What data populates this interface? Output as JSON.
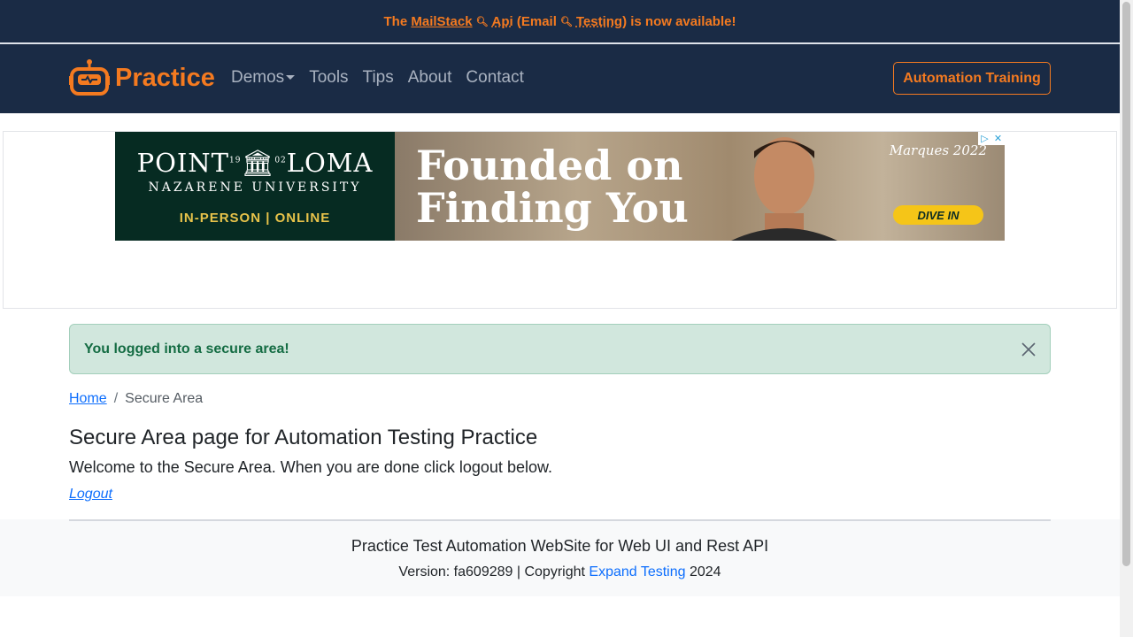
{
  "announcement": {
    "prefix": "The",
    "mailstack": "MailStack",
    "api": "Api",
    "email_open": "(Email",
    "testing": "Testing)",
    "suffix": "is now available!"
  },
  "navbar": {
    "brand": "Practice",
    "links": [
      "Demos",
      "Tools",
      "Tips",
      "About",
      "Contact"
    ],
    "cta": "Automation Training"
  },
  "ad": {
    "logo": "POINT",
    "logo_year_left": "19",
    "logo_year_right": "02",
    "logo_end": "LOMA",
    "subtitle": "NAZARENE UNIVERSITY",
    "mode": "IN-PERSON | ONLINE",
    "headline_1": "Founded on",
    "headline_2": "Finding You",
    "tag": "Marques 2022",
    "cta": "DIVE IN"
  },
  "alert": {
    "message": "You logged into a secure area!"
  },
  "breadcrumb": {
    "home": "Home",
    "separator": "/",
    "current": "Secure Area"
  },
  "main": {
    "title": "Secure Area page for Automation Testing Practice",
    "welcome": "Welcome to the Secure Area. When you are done click logout below.",
    "logout": "Logout"
  },
  "footer": {
    "title": "Practice Test Automation WebSite for Web UI and Rest API",
    "version_prefix": "Version: fa609289 | Copyright",
    "company": "Expand Testing",
    "year": "2024"
  },
  "colors": {
    "navy": "#1a2b45",
    "orange": "#f47a20",
    "link": "#0d6efd",
    "success_bg": "#d1e7dd",
    "success_text": "#146c43"
  }
}
